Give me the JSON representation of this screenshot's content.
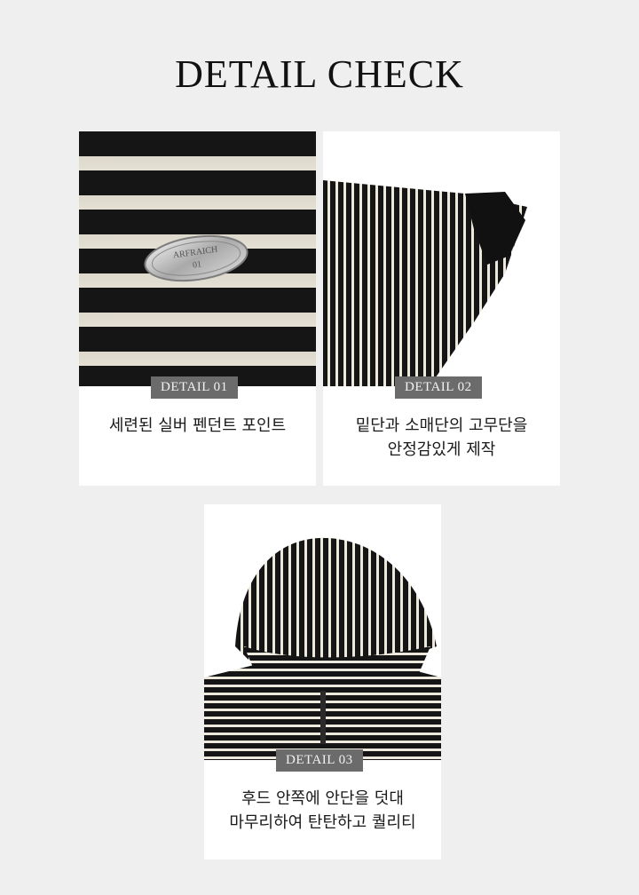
{
  "page": {
    "title": "DETAIL CHECK"
  },
  "details": [
    {
      "tag": "DETAIL 01",
      "caption_lines": [
        "세련된 실버 펜던트 포인트"
      ],
      "pendant_text": [
        "ARFRAICH",
        "01"
      ]
    },
    {
      "tag": "DETAIL 02",
      "caption_lines": [
        "밑단과 소매단의 고무단을",
        "안정감있게 제작"
      ]
    },
    {
      "tag": "DETAIL 03",
      "caption_lines": [
        "후드 안쪽에 안단을 덧대",
        "마무리하여 탄탄하고 퀄리티"
      ]
    }
  ],
  "colors": {
    "background": "#efefef",
    "card": "#ffffff",
    "tag_bg": "#6b6b6b",
    "knit_dark": "#151515",
    "knit_light": "#e4e0d4"
  }
}
